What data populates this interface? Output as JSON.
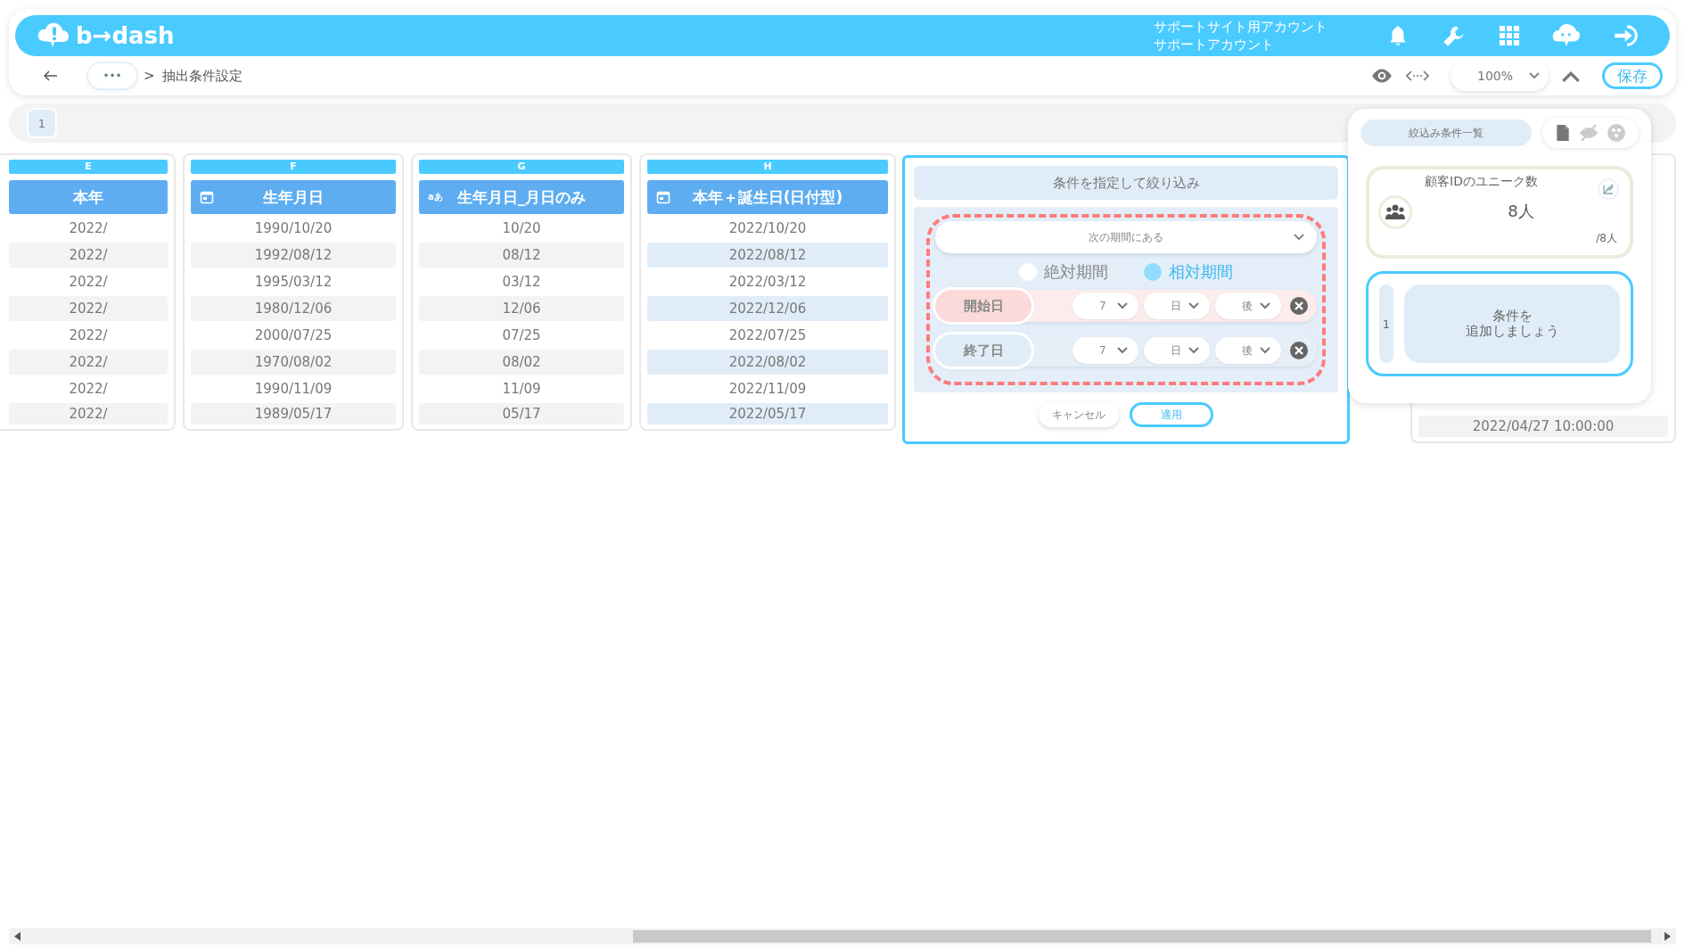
{
  "header": {
    "logo": "b→dash",
    "account_lines": [
      "サポートサイト用アカウント",
      "サポートアカウント"
    ]
  },
  "toolbar": {
    "breadcrumb_more": "•••",
    "breadcrumb_separator": ">",
    "breadcrumb_current": "抽出条件設定",
    "zoom": "100%",
    "save": "保存"
  },
  "sheet_tabs": [
    {
      "label": "1",
      "selected": true
    }
  ],
  "columns": [
    {
      "letter": "E",
      "title": "本年",
      "kind": "plain",
      "selected": false,
      "cells": [
        "2022/",
        "2022/",
        "2022/",
        "2022/",
        "2022/",
        "2022/",
        "2022/",
        "2022/"
      ]
    },
    {
      "letter": "F",
      "title": "生年月日",
      "kind": "date",
      "selected": false,
      "cells": [
        "1990/10/20",
        "1992/08/12",
        "1995/03/12",
        "1980/12/06",
        "2000/07/25",
        "1970/08/02",
        "1990/11/09",
        "1989/05/17"
      ]
    },
    {
      "letter": "G",
      "title": "生年月日_月日のみ",
      "kind": "text",
      "type_glyph": "aあ",
      "selected": false,
      "cells": [
        "10/20",
        "08/12",
        "03/12",
        "12/06",
        "07/25",
        "08/02",
        "11/09",
        "05/17"
      ]
    },
    {
      "letter": "H",
      "title": "本年＋誕生日(日付型)",
      "kind": "date",
      "selected": true,
      "cells": [
        "2022/10/20",
        "2022/08/12",
        "2022/03/12",
        "2022/12/06",
        "2022/07/25",
        "2022/08/02",
        "2022/11/09",
        "2022/05/17"
      ]
    }
  ],
  "hidden_column_cell": "2022/04/27 10:00:00",
  "filter_popup": {
    "title": "条件を指定して絞り込み",
    "operator": "次の期間にある",
    "period_types": [
      {
        "label": "絶対期間",
        "selected": false
      },
      {
        "label": "相対期間",
        "selected": true
      }
    ],
    "rows": [
      {
        "kind": "start",
        "label": "開始日",
        "amount": "7",
        "unit": "日",
        "direction": "後"
      },
      {
        "kind": "end",
        "label": "終了日",
        "amount": "7",
        "unit": "日",
        "direction": "後"
      }
    ],
    "cancel": "キャンセル",
    "apply": "適用"
  },
  "conditions_panel": {
    "title": "絞込み条件一覧",
    "metric": {
      "label": "顧客IDのユニーク数",
      "value": "8人",
      "total": "/8人"
    },
    "condition": {
      "index": "1",
      "lines": [
        "条件を",
        "追加しましょう"
      ]
    }
  }
}
